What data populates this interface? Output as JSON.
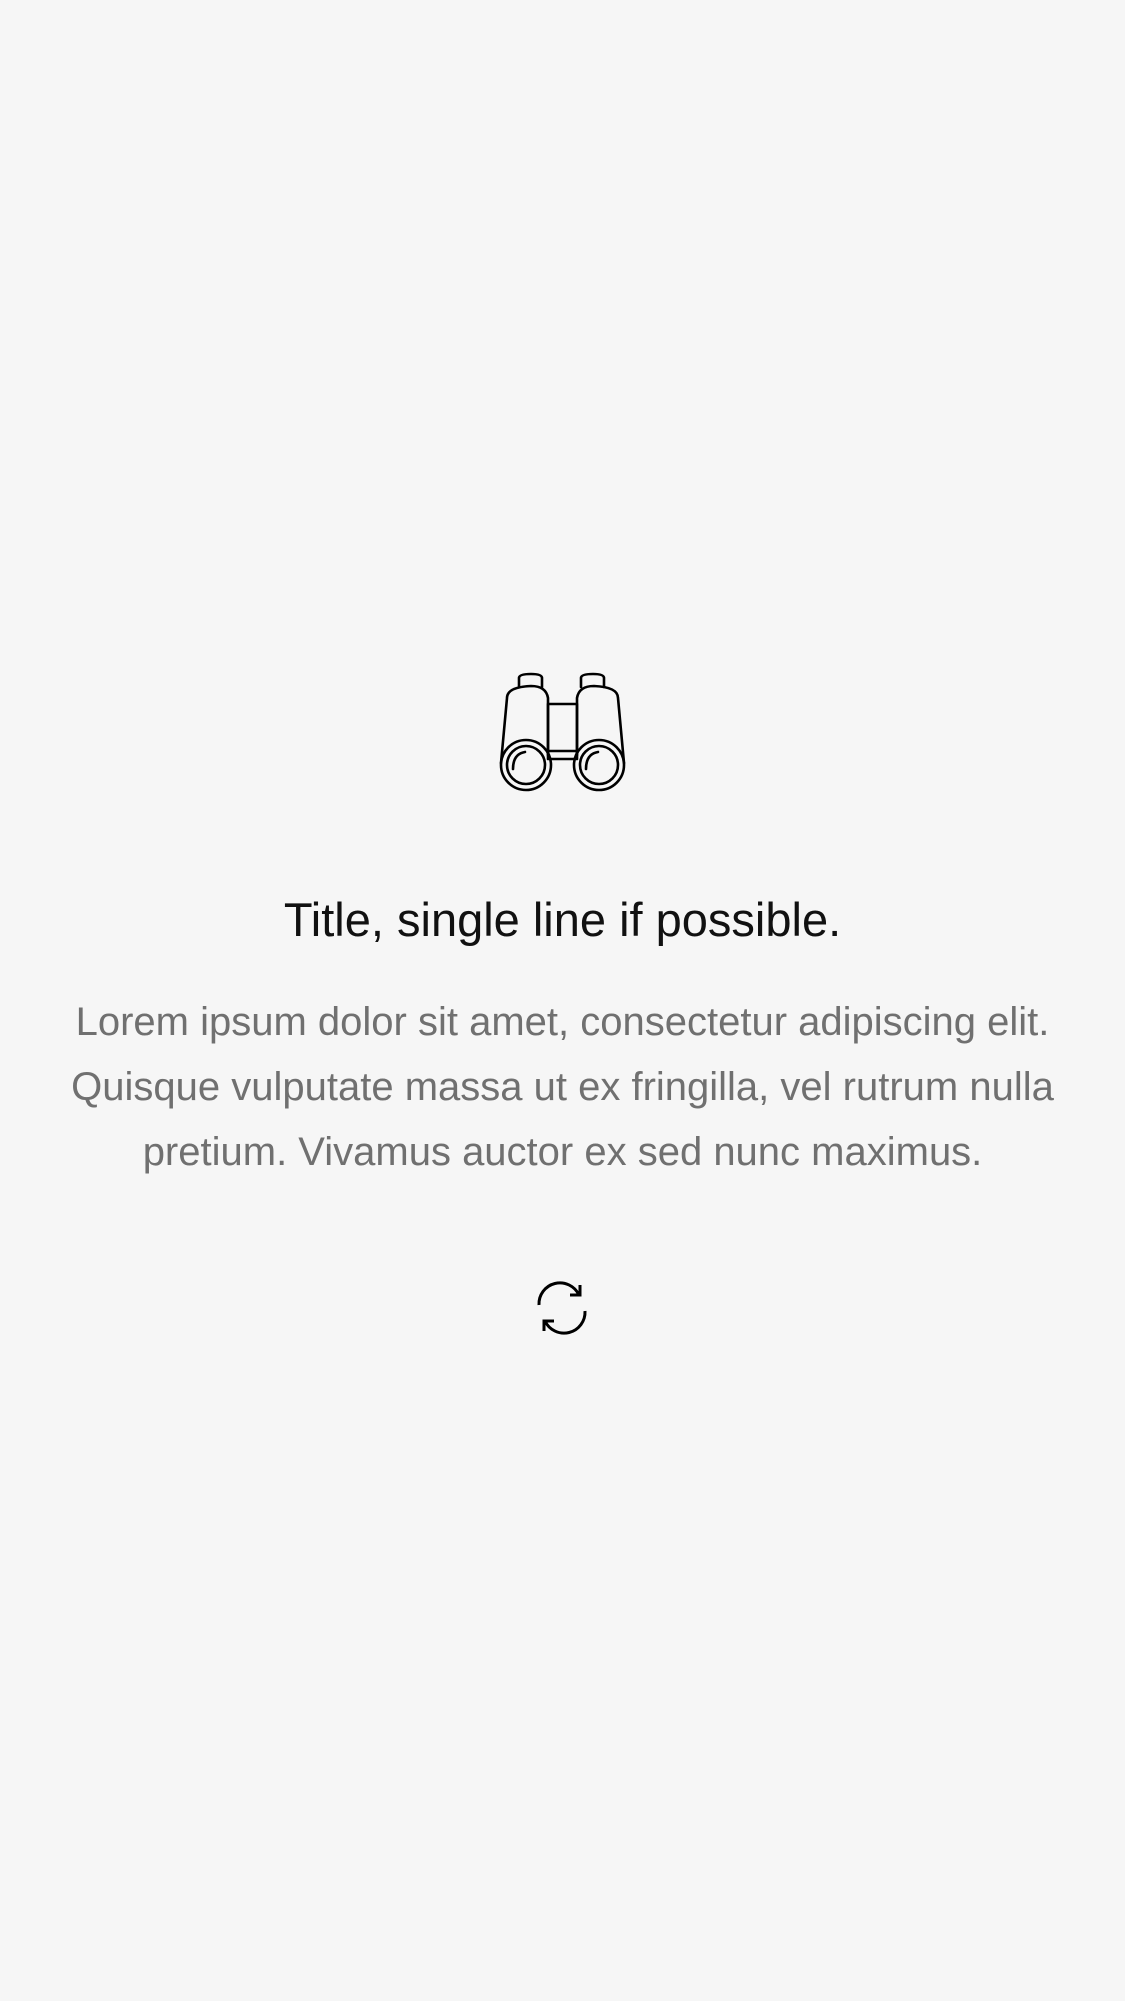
{
  "empty_state": {
    "icon": "binoculars-icon",
    "title": "Title, single line if possible.",
    "message": "Lorem ipsum dolor sit amet, consectetur adipiscing elit. Quisque vulputate massa ut ex fringilla, vel rutrum nulla pretium. Vivamus auctor ex sed nunc maximus.",
    "action_icon": "refresh-icon"
  },
  "colors": {
    "background": "#f6f6f6",
    "title": "#111111",
    "message": "#707070",
    "icon_stroke": "#000000"
  }
}
